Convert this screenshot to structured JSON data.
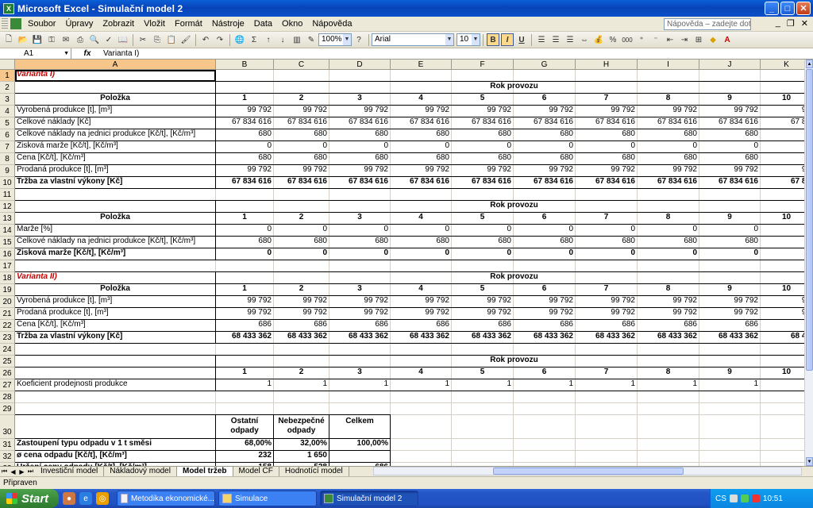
{
  "title": "Microsoft Excel - Simulační model 2",
  "window_buttons": {
    "minimize": "_",
    "maximize": "□",
    "close": "✕"
  },
  "menu": [
    "Soubor",
    "Úpravy",
    "Zobrazit",
    "Vložit",
    "Formát",
    "Nástroje",
    "Data",
    "Okno",
    "Nápověda"
  ],
  "help_placeholder": "Nápověda – zadejte dotaz",
  "toolbar": {
    "zoom": "100%",
    "font": "Arial",
    "size": "10",
    "bold": "B",
    "italic": "I",
    "underline": "U",
    "percent": "%",
    "thousands": "000",
    "sigma": "Σ"
  },
  "formula": {
    "namebox": "A1",
    "fx": "fx",
    "value": "Varianta I)"
  },
  "columns": [
    "A",
    "B",
    "C",
    "D",
    "E",
    "F",
    "G",
    "H",
    "I",
    "J",
    "K"
  ],
  "rows": [
    "1",
    "2",
    "3",
    "4",
    "5",
    "6",
    "7",
    "8",
    "9",
    "10",
    "11",
    "12",
    "13",
    "14",
    "15",
    "16",
    "17",
    "18",
    "19",
    "20",
    "21",
    "22",
    "23",
    "24",
    "25",
    "26",
    "27",
    "28",
    "29",
    "30",
    "31",
    "32",
    "33",
    "34"
  ],
  "grid": {
    "a1": "Varianta I)",
    "rok": "Rok provozu",
    "polozka": "Položka",
    "years": [
      "1",
      "2",
      "3",
      "4",
      "5",
      "6",
      "7",
      "8",
      "9",
      "10"
    ],
    "r4": {
      "label": "Vyrobená produkce [t], [m³]",
      "vals": [
        "99 792",
        "99 792",
        "99 792",
        "99 792",
        "99 792",
        "99 792",
        "99 792",
        "99 792",
        "99 792",
        "99"
      ]
    },
    "r5": {
      "label": "Celkové náklady [Kč]",
      "vals": [
        "67 834 616",
        "67 834 616",
        "67 834 616",
        "67 834 616",
        "67 834 616",
        "67 834 616",
        "67 834 616",
        "67 834 616",
        "67 834 616",
        "67 83"
      ]
    },
    "r6": {
      "label": "Celkové náklady na jednici produkce [Kč/t], [Kč/m³]",
      "vals": [
        "680",
        "680",
        "680",
        "680",
        "680",
        "680",
        "680",
        "680",
        "680"
      ]
    },
    "r7": {
      "label": "Zisková marže [Kč/t], [Kč/m³]",
      "vals": [
        "0",
        "0",
        "0",
        "0",
        "0",
        "0",
        "0",
        "0",
        "0"
      ]
    },
    "r8": {
      "label": "Cena [Kč/t], [Kč/m³]",
      "vals": [
        "680",
        "680",
        "680",
        "680",
        "680",
        "680",
        "680",
        "680",
        "680"
      ]
    },
    "r9": {
      "label": "Prodaná produkce [t], [m³]",
      "vals": [
        "99 792",
        "99 792",
        "99 792",
        "99 792",
        "99 792",
        "99 792",
        "99 792",
        "99 792",
        "99 792",
        "99"
      ]
    },
    "r10": {
      "label": "Tržba za vlastní výkony [Kč]",
      "vals": [
        "67 834 616",
        "67 834 616",
        "67 834 616",
        "67 834 616",
        "67 834 616",
        "67 834 616",
        "67 834 616",
        "67 834 616",
        "67 834 616",
        "67 83"
      ]
    },
    "r14": {
      "label": "Marže [%]",
      "vals": [
        "0",
        "0",
        "0",
        "0",
        "0",
        "0",
        "0",
        "0",
        "0"
      ]
    },
    "r15": {
      "label": "Celkové náklady na jednici produkce [Kč/t], [Kč/m³]",
      "vals": [
        "680",
        "680",
        "680",
        "680",
        "680",
        "680",
        "680",
        "680",
        "680"
      ]
    },
    "r16": {
      "label": "Zisková marže [Kč/t], [Kč/m³]",
      "vals": [
        "0",
        "0",
        "0",
        "0",
        "0",
        "0",
        "0",
        "0",
        "0"
      ]
    },
    "a18": "Varianta II)",
    "r20": {
      "label": "Vyrobená produkce [t], [m³]",
      "vals": [
        "99 792",
        "99 792",
        "99 792",
        "99 792",
        "99 792",
        "99 792",
        "99 792",
        "99 792",
        "99 792",
        "99"
      ]
    },
    "r21": {
      "label": "Prodaná produkce [t], [m³]",
      "vals": [
        "99 792",
        "99 792",
        "99 792",
        "99 792",
        "99 792",
        "99 792",
        "99 792",
        "99 792",
        "99 792",
        "99"
      ]
    },
    "r22": {
      "label": "Cena [Kč/t], [Kč/m³]",
      "vals": [
        "686",
        "686",
        "686",
        "686",
        "686",
        "686",
        "686",
        "686",
        "686"
      ]
    },
    "r23": {
      "label": "Tržba za vlastní výkony [Kč]",
      "vals": [
        "68 433 362",
        "68 433 362",
        "68 433 362",
        "68 433 362",
        "68 433 362",
        "68 433 362",
        "68 433 362",
        "68 433 362",
        "68 433 362",
        "68 43"
      ]
    },
    "r27": {
      "label": "Koeficient prodejnosti produkce",
      "vals": [
        "1",
        "1",
        "1",
        "1",
        "1",
        "1",
        "1",
        "1",
        "1"
      ]
    },
    "h30": [
      "Ostatní odpady",
      "Nebezpečné odpady",
      "Celkem"
    ],
    "r31": {
      "label": "Zastoupení typu odpadu v 1 t směsi",
      "vals": [
        "68,00%",
        "32,00%",
        "100,00%"
      ]
    },
    "r32": {
      "label": "ø cena odpadu [Kč/t], [Kč/m³]",
      "vals": [
        "232",
        "1 650",
        ""
      ]
    },
    "r33": {
      "label": "Určení ceny odpadu [Kč/t], [Kč/m³]",
      "vals": [
        "158",
        "528",
        "686"
      ]
    }
  },
  "sheets": [
    "Investiční model",
    "Nákladový model",
    "Model tržeb",
    "Model CF",
    "Hodnotící model"
  ],
  "active_sheet": "Model tržeb",
  "status": "Připraven",
  "taskbar": {
    "start": "Start",
    "tasks": [
      "Metodika ekonomické...",
      "Simulace",
      "Simulační model 2"
    ],
    "lang": "CS",
    "clock": "10:51"
  }
}
